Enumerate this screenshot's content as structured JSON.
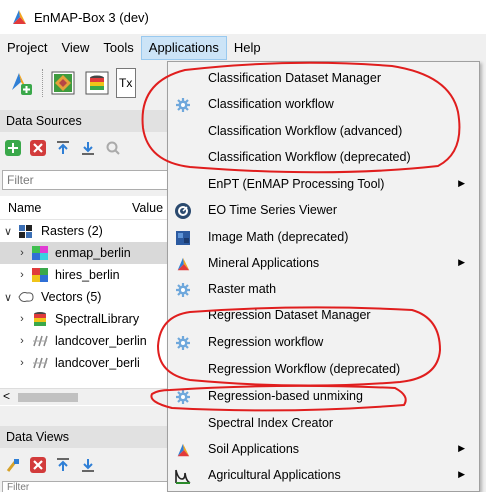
{
  "window": {
    "title": "EnMAP-Box 3 (dev)"
  },
  "menubar": [
    "Project",
    "View",
    "Tools",
    "Applications",
    "Help"
  ],
  "data_sources": {
    "header": "Data Sources",
    "filter_placeholder": "Filter",
    "columns": [
      "Name",
      "Value"
    ],
    "rasters_label": "Rasters (2)",
    "rasters": [
      "enmap_berlin",
      "hires_berlin"
    ],
    "vectors_label": "Vectors (5)",
    "vectors": [
      "SpectralLibrary",
      "landcover_berlin",
      "landcover_berli"
    ]
  },
  "data_views": {
    "header": "Data Views",
    "filter_placeholder": "Filter"
  },
  "toolbar_partial_text": "Tx",
  "applications_menu": [
    {
      "label": "Classification Dataset Manager",
      "icon": "none",
      "submenu": false
    },
    {
      "label": "Classification workflow",
      "icon": "gear-icon",
      "submenu": false
    },
    {
      "label": "Classification Workflow (advanced)",
      "icon": "none",
      "submenu": false
    },
    {
      "label": "Classification Workflow (deprecated)",
      "icon": "none",
      "submenu": false
    },
    {
      "label": "EnPT (EnMAP Processing Tool)",
      "icon": "none",
      "submenu": true
    },
    {
      "label": "EO Time Series Viewer",
      "icon": "eo-time-series-icon",
      "submenu": false
    },
    {
      "label": "Image Math (deprecated)",
      "icon": "image-math-icon",
      "submenu": false
    },
    {
      "label": "Mineral Applications",
      "icon": "enmap-logo-icon",
      "submenu": true
    },
    {
      "label": "Raster math",
      "icon": "gear-icon",
      "submenu": false
    },
    {
      "label": "Regression Dataset Manager",
      "icon": "none",
      "submenu": false
    },
    {
      "label": "Regression workflow",
      "icon": "gear-icon",
      "submenu": false
    },
    {
      "label": "Regression Workflow (deprecated)",
      "icon": "none",
      "submenu": false
    },
    {
      "label": "Regression-based unmixing",
      "icon": "gear-icon",
      "submenu": false
    },
    {
      "label": "Spectral Index Creator",
      "icon": "none",
      "submenu": false
    },
    {
      "label": "Soil Applications",
      "icon": "enmap-logo-icon",
      "submenu": true
    },
    {
      "label": "Agricultural Applications",
      "icon": "agri-icon",
      "submenu": true
    }
  ],
  "annotation_color": "#e01e1e"
}
